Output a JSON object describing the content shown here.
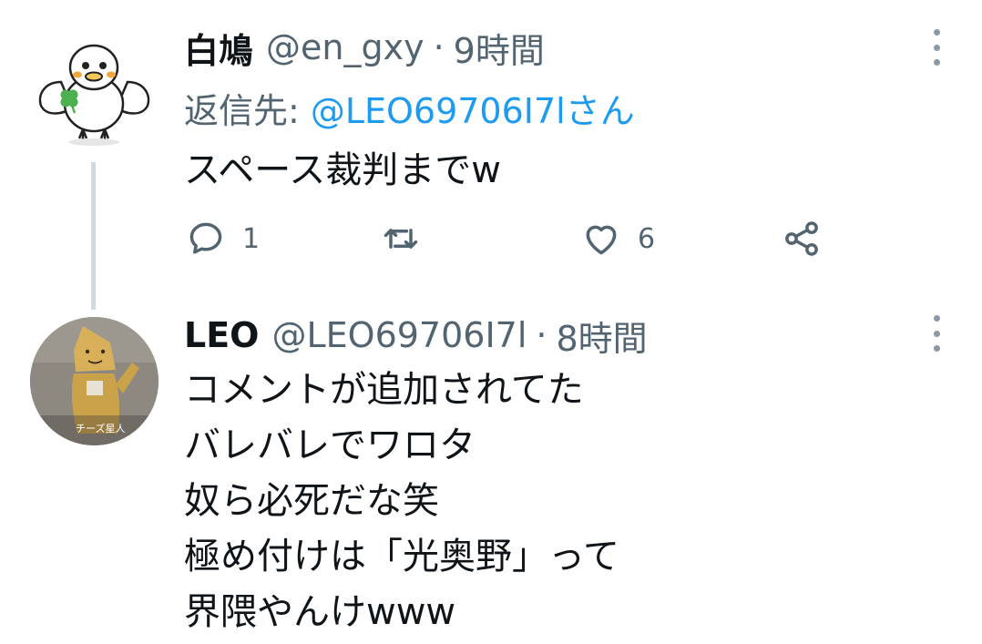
{
  "tweets": [
    {
      "display_name": "白鳩",
      "handle": "@en_gxy",
      "separator": "·",
      "time": "9時間",
      "reply_to_label": "返信先:",
      "reply_to_mention": "@LEO69706I7lさん",
      "text_lines": [
        "スペース裁判までw"
      ],
      "reply_count": "1",
      "retweet_count": "",
      "like_count": "6"
    },
    {
      "display_name": "LEO",
      "handle": "@LEO69706I7l",
      "separator": "·",
      "time": "8時間",
      "avatar_caption": "チーズ星人",
      "text_lines": [
        "コメントが追加されてた",
        "バレバレでワロタ",
        "奴ら必死だな笑",
        "極め付けは「光奥野」って",
        "界隈やんけwww"
      ]
    }
  ],
  "icons": {
    "reply": "speech-bubble-icon",
    "retweet": "retweet-arrows-icon",
    "like": "heart-icon",
    "share": "share-nodes-icon",
    "more": "vertical-dots-icon"
  },
  "colors": {
    "text": "#0f1419",
    "secondary": "#536471",
    "mention": "#1d9bf0",
    "thread_line": "#cfd9de"
  }
}
